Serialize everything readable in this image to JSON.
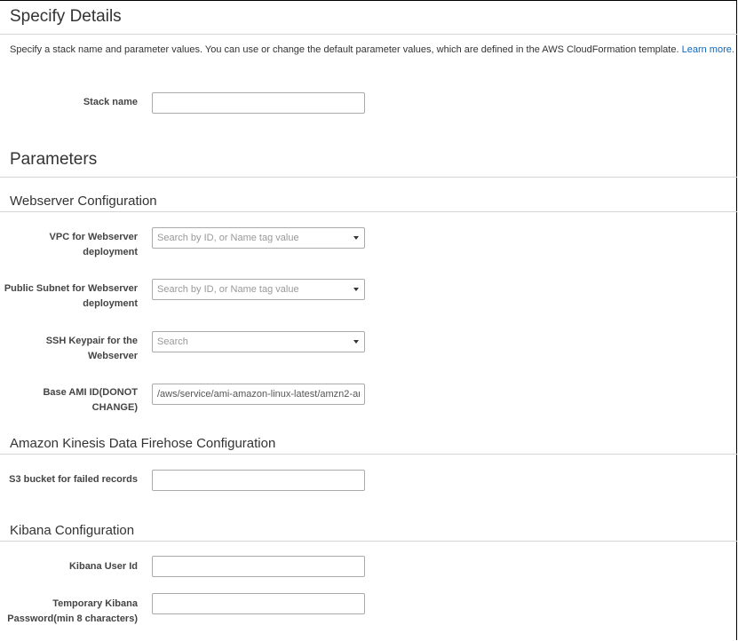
{
  "specify_details": {
    "title": "Specify Details",
    "description": "Specify a stack name and parameter values. You can use or change the default parameter values, which are defined in the AWS CloudFormation template.",
    "learn_more": "Learn more.",
    "stack_name_label": "Stack name",
    "stack_name_value": ""
  },
  "parameters": {
    "title": "Parameters"
  },
  "webserver_config": {
    "title": "Webserver Configuration",
    "vpc_label": "VPC for Webserver deployment",
    "vpc_placeholder": "Search by ID, or Name tag value",
    "subnet_label": "Public Subnet for Webserver deployment",
    "subnet_placeholder": "Search by ID, or Name tag value",
    "keypair_label": "SSH Keypair for the Webserver",
    "keypair_placeholder": "Search",
    "ami_label": "Base AMI ID(DONOT CHANGE)",
    "ami_value": "/aws/service/ami-amazon-linux-latest/amzn2-ar"
  },
  "firehose_config": {
    "title": "Amazon Kinesis Data Firehose Configuration",
    "s3_label": "S3 bucket for failed records",
    "s3_value": ""
  },
  "kibana_config": {
    "title": "Kibana Configuration",
    "user_label": "Kibana User Id",
    "user_value": "",
    "password_label": "Temporary Kibana Password(min 8 characters)",
    "password_value": ""
  },
  "colors": {
    "link": "#1166bb",
    "text": "#333333",
    "border": "#aaaaaa",
    "rule": "#d5d5d5"
  }
}
